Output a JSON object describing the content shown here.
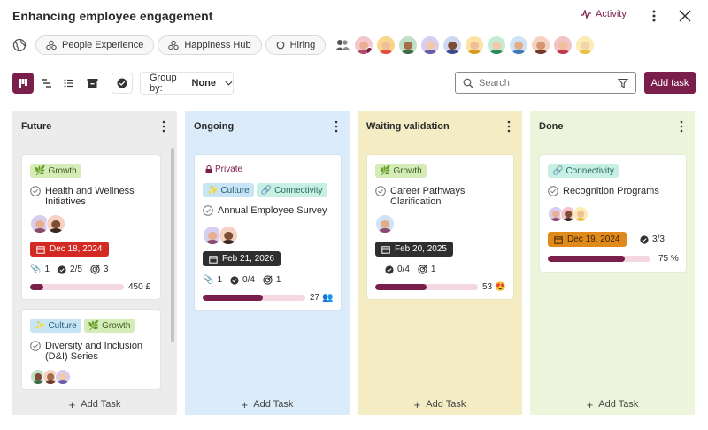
{
  "header": {
    "title": "Enhancing employee engagement",
    "activity_label": "Activity"
  },
  "spaces": [
    {
      "label": "People Experience"
    },
    {
      "label": "Happiness Hub"
    },
    {
      "label": "Hiring"
    }
  ],
  "toolbar": {
    "groupby_label": "Group by:",
    "groupby_value": "None",
    "search_placeholder": "Search",
    "add_task_label": "Add task"
  },
  "tag_labels": {
    "growth": "Growth",
    "culture": "Culture",
    "connectivity": "Connectivity",
    "private": "Private"
  },
  "columns": [
    {
      "name": "Future",
      "bg": "#ececec",
      "add_label": "Add Task",
      "cards": [
        {
          "title_1": "Health and Wellness",
          "title_2": "Initiatives",
          "date": "Dec 18, 2024",
          "attachments": "1",
          "subtasks": "2/5",
          "goals": "3",
          "progress": 0.14,
          "progress_label": "450 £"
        },
        {
          "title_1": "Diversity and Inclusion",
          "title_2": "(D&I) Series"
        }
      ]
    },
    {
      "name": "Ongoing",
      "bg": "#dcebf9",
      "add_label": "Add Task",
      "cards": [
        {
          "title_1": "Annual Employee Survey",
          "date": "Feb 21, 2026",
          "attachments": "1",
          "subtasks": "0/4",
          "goals": "1",
          "progress": 0.59,
          "progress_label": "27"
        }
      ]
    },
    {
      "name": "Waiting validation",
      "bg": "#f3ecc4",
      "add_label": "Add Task",
      "cards": [
        {
          "title_1": "Career Pathways",
          "title_2": "Clarification",
          "date": "Feb 20, 2025",
          "subtasks": "0/4",
          "goals": "1",
          "progress": 0.5,
          "progress_label": "53"
        }
      ]
    },
    {
      "name": "Done",
      "bg": "#edf4dc",
      "add_label": "Add Task",
      "cards": [
        {
          "title_1": "Recognition Programs",
          "date": "Dec 19, 2024",
          "subtasks": "3/3",
          "progress": 0.75,
          "progress_label": "75 %"
        }
      ]
    }
  ],
  "colors": {
    "accent": "#7a1f4b",
    "progress_track": "#f5d7e3",
    "overdue": "#d32a24",
    "due_soon": "#e08a1c"
  }
}
